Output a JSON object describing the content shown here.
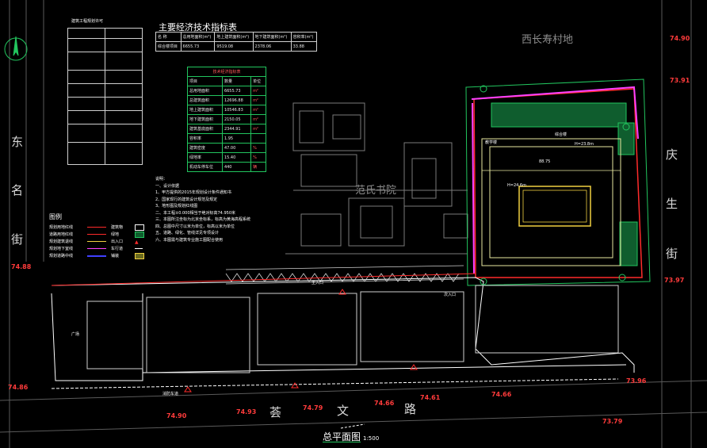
{
  "drawing": {
    "title": "总平面图",
    "scale": "1:500",
    "neighbors": {
      "north": "西长寿村地",
      "center": "范氏书院"
    },
    "streets": {
      "west": [
        "东",
        "名",
        "街"
      ],
      "east": [
        "庆",
        "生",
        "街"
      ],
      "south": [
        "荟",
        "文",
        "路"
      ]
    },
    "elevations": [
      {
        "id": "w1",
        "text": "74.88"
      },
      {
        "id": "w2",
        "text": "74.86"
      },
      {
        "id": "s1",
        "text": "74.90"
      },
      {
        "id": "s2",
        "text": "74.93"
      },
      {
        "id": "s3",
        "text": "74.79"
      },
      {
        "id": "s4",
        "text": "74.66"
      },
      {
        "id": "s5",
        "text": "74.61"
      },
      {
        "id": "s6",
        "text": "74.66"
      },
      {
        "id": "s7",
        "text": "73.79"
      },
      {
        "id": "e1",
        "text": "73.91"
      },
      {
        "id": "e2",
        "text": "73.97"
      },
      {
        "id": "e3",
        "text": "73.96"
      },
      {
        "id": "e4",
        "text": "74.90"
      }
    ],
    "table_main_title": "主要经济技术指标表",
    "table_main": {
      "headers": [
        "名 称",
        "总用地面积(m²)",
        "地上建筑面积(m²)",
        "地下建筑面积(m²)",
        "容积率(m²)"
      ],
      "row": [
        "综合楼项目",
        "6655.73",
        "9519.08",
        "2378.06",
        "33.88"
      ]
    },
    "table_indicators": {
      "title": "技术经济指标表",
      "headers": [
        "项目",
        "数量",
        "单位"
      ],
      "rows": [
        [
          "总用地面积",
          "6655.73",
          "m²"
        ],
        [
          "总建筑面积",
          "12696.88",
          "m²"
        ],
        [
          "地上建筑面积",
          "10546.83",
          "m²"
        ],
        [
          "地下建筑面积",
          "2150.05",
          "m²"
        ],
        [
          "建筑基底面积",
          "2344.91",
          "m²"
        ],
        [
          "容积率",
          "1.95",
          ""
        ],
        [
          "建筑密度",
          "47.00",
          "%"
        ],
        [
          "绿地率",
          "15.40",
          "%"
        ],
        [
          "机动车停车位",
          "440",
          "辆"
        ]
      ]
    },
    "legend": {
      "title": "图例",
      "items": [
        {
          "label": "规划用地红线",
          "sym": "建筑物"
        },
        {
          "label": "道路用地红线",
          "sym": "绿地"
        },
        {
          "label": "规划建筑退线",
          "sym": "出入口"
        },
        {
          "label": "规划地下室线",
          "sym": "车行道"
        },
        {
          "label": "规划道路中线",
          "sym": "铺装"
        }
      ]
    },
    "notes_title": "说明：",
    "notes": [
      "一、设计依据",
      "1、甲方提供的2015年规划设计条件通知书",
      "2、国家现行的建筑设计规范及规定",
      "3、地形图及规划红线图",
      "二、本工程±0.000相当于绝对标高74.950米",
      "三、本图所注坐标为北京坐标系，标高为黄海高程系统",
      "四、总图中尺寸以米为单位，标高以米为单位",
      "五、道路、绿化、管线详见专项设计",
      "六、本图需与建筑专业施工图配合使用"
    ],
    "building_labels": [
      {
        "id": "b1",
        "text": "综合楼"
      },
      {
        "id": "b2",
        "text": "教学楼"
      },
      {
        "id": "b3",
        "text": "H=23.8m"
      },
      {
        "id": "b4",
        "text": "H=24.6m"
      },
      {
        "id": "b5",
        "text": "主入口"
      },
      {
        "id": "b6",
        "text": "次入口"
      },
      {
        "id": "b7",
        "text": "消防车道"
      },
      {
        "id": "b8",
        "text": "广场"
      }
    ],
    "dimension_label": "88.75"
  }
}
